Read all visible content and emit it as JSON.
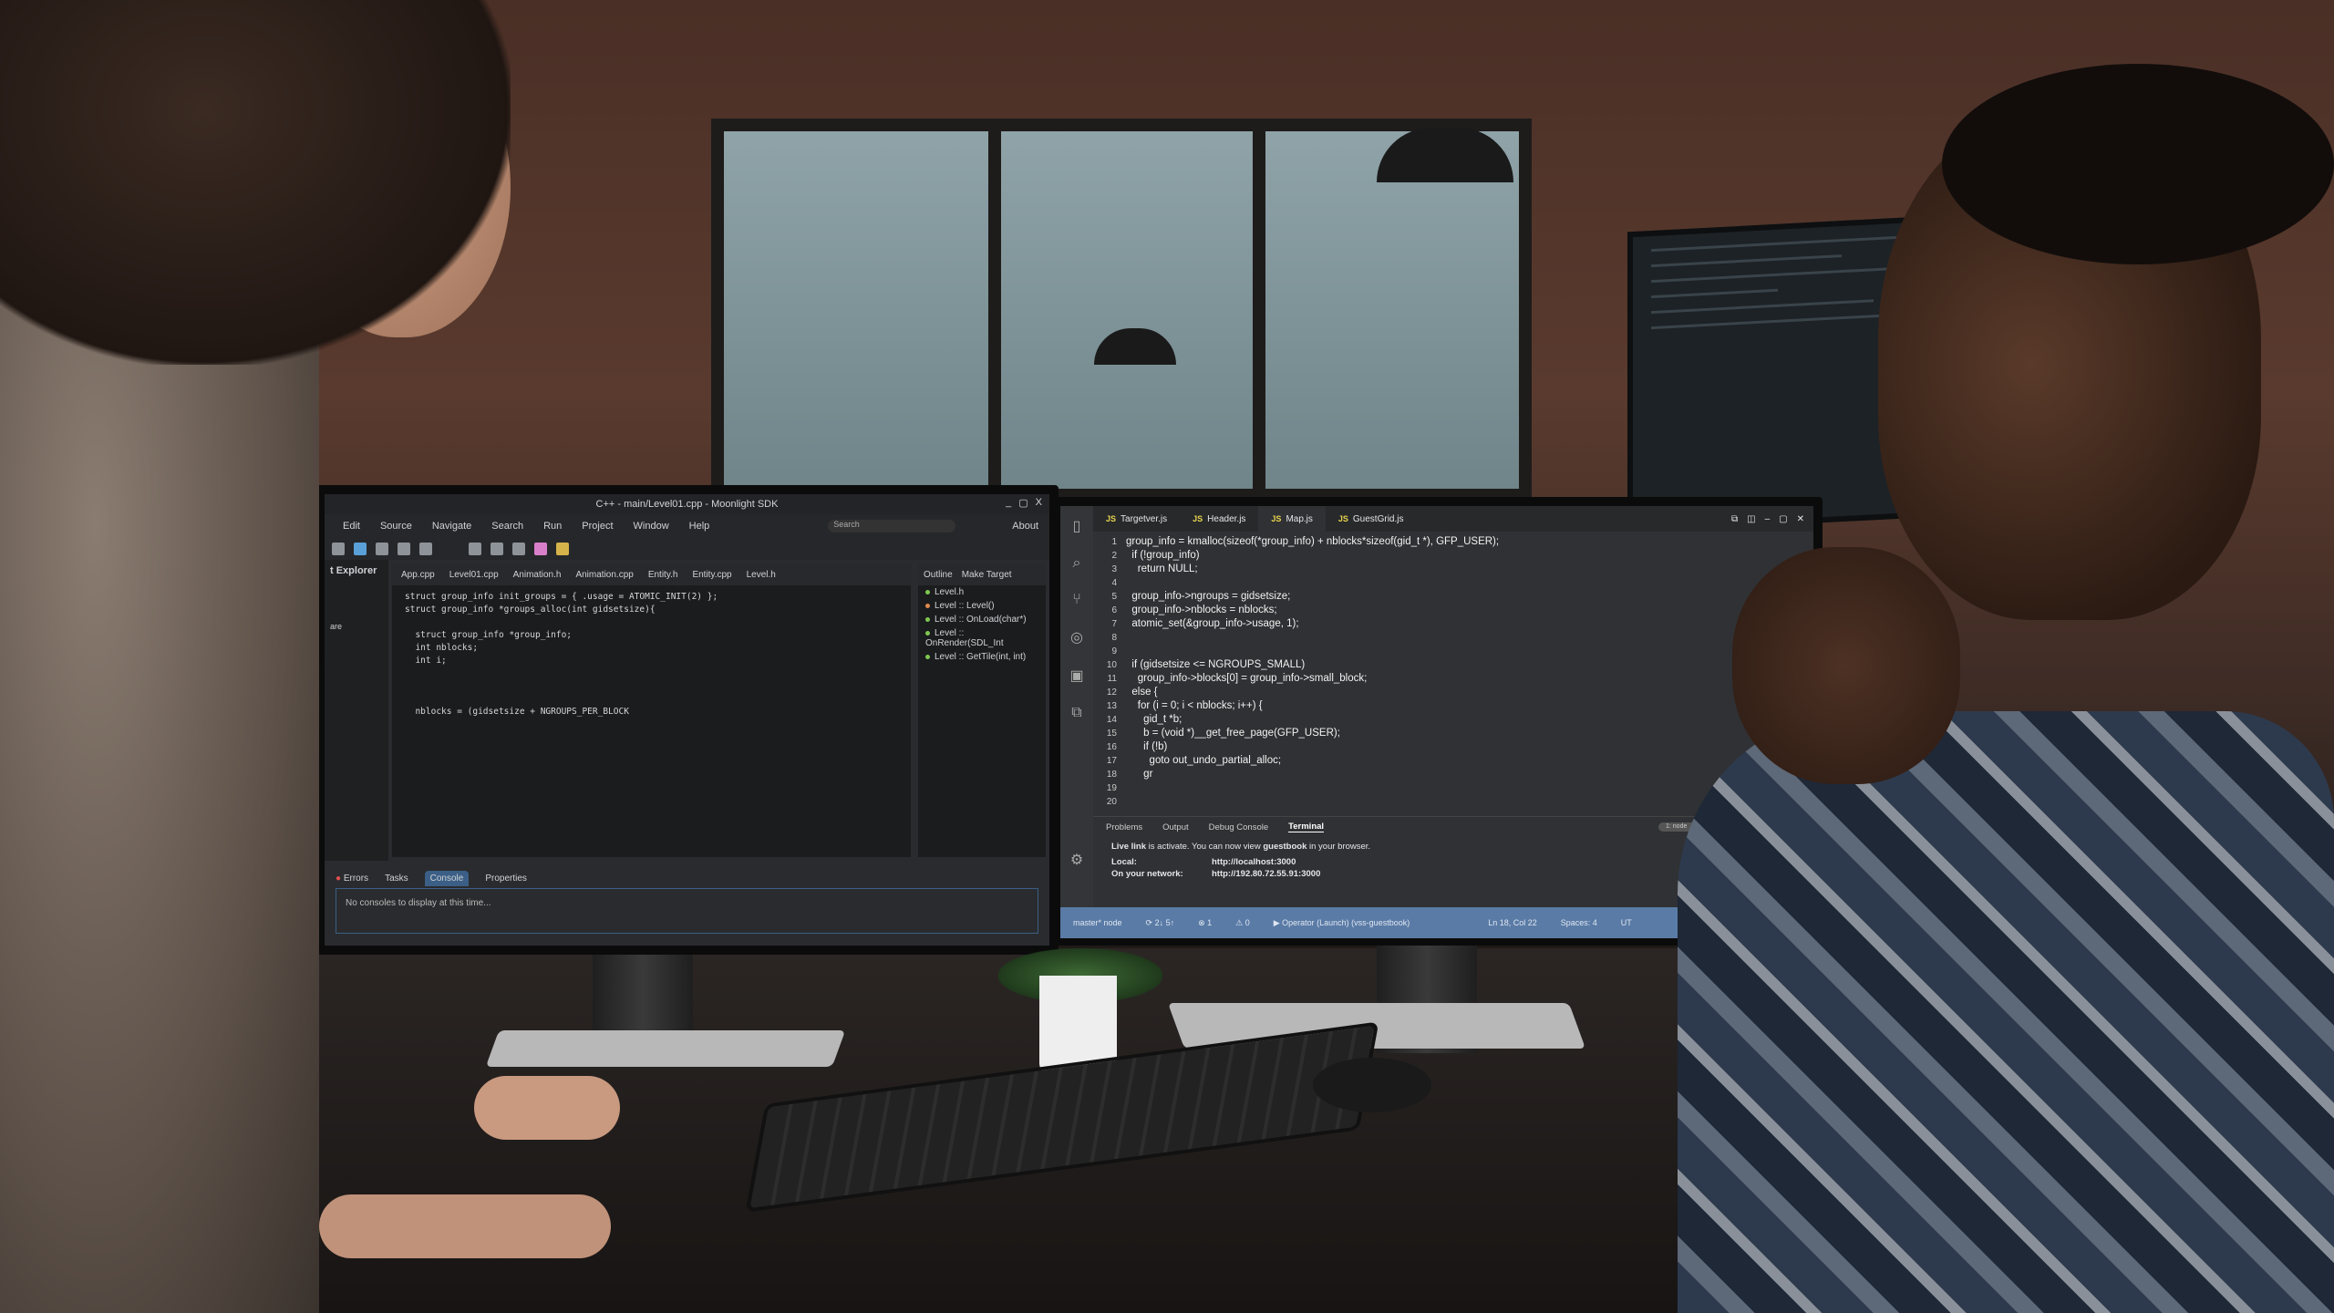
{
  "left_ide": {
    "title": "C++ - main/Level01.cpp - Moonlight SDK",
    "window_controls": [
      "_",
      "▢",
      "X"
    ],
    "menu": [
      "Edit",
      "Source",
      "Navigate",
      "Search",
      "Run",
      "Project",
      "Window",
      "Help"
    ],
    "search_placeholder": "Search",
    "about": "About",
    "explorer_title": "t Explorer",
    "explorer_item": "are",
    "editor_tabs": [
      "App.cpp",
      "Level01.cpp",
      "Animation.h",
      "Animation.cpp",
      "Entity.h",
      "Entity.cpp",
      "Level.h"
    ],
    "code": "struct group_info init_groups = { .usage = ATOMIC_INIT(2) };\nstruct group_info *groups_alloc(int gidsetsize){\n\n  struct group_info *group_info;\n  int nblocks;\n  int i;\n\n\n\n  nblocks = (gidsetsize + NGROUPS_PER_BLOCK",
    "outline_tabs": [
      "Outline",
      "Make Target"
    ],
    "outline_items": [
      "Level.h",
      "Level :: Level()",
      "Level :: OnLoad(char*)",
      "Level :: OnRender(SDL_Int",
      "Level :: GetTile(int, int)"
    ],
    "bottom_tabs": [
      "Errors",
      "Tasks",
      "Console",
      "Properties"
    ],
    "console_message": "No consoles to display at this time..."
  },
  "right_ide": {
    "tabs": [
      {
        "icon": "JS",
        "label": "Targetver.js",
        "active": false
      },
      {
        "icon": "JS",
        "label": "Header.js",
        "active": false
      },
      {
        "icon": "JS",
        "label": "Map.js",
        "active": true
      },
      {
        "icon": "JS",
        "label": "GuestGrid.js",
        "active": false
      }
    ],
    "line_numbers": "1\n2\n3\n4\n5\n6\n7\n8\n9\n10\n11\n12\n13\n14\n15\n16\n17\n18\n19\n20",
    "code": "group_info = kmalloc(sizeof(*group_info) + nblocks*sizeof(gid_t *), GFP_USER);\n  if (!group_info)\n    return NULL;\n\n  group_info->ngroups = gidsetsize;\n  group_info->nblocks = nblocks;\n  atomic_set(&group_info->usage, 1);\n\n\n  if (gidsetsize <= NGROUPS_SMALL)\n    group_info->blocks[0] = group_info->small_block;\n  else {\n    for (i = 0; i < nblocks; i++) {\n      gid_t *b;\n      b = (void *)__get_free_page(GFP_USER);\n      if (!b)\n        goto out_undo_partial_alloc;\n      gr\n",
    "panel_tabs": [
      "Problems",
      "Output",
      "Debug Console",
      "Terminal"
    ],
    "active_panel": "Terminal",
    "terminal_select": "1: node",
    "terminal": {
      "message_bold1": "Live link",
      "message_mid": " is activate. You can now view ",
      "message_bold2": "guestbook",
      "message_end": " in your browser.",
      "local_label": "Local:",
      "local_url": "http://localhost:3000",
      "network_label": "On your network:",
      "network_url": "http://192.80.72.55.91:3000"
    },
    "status_bar": [
      "master* node",
      "⟳ 2↓ 5↑",
      "⊗ 1",
      "⚠ 0",
      "▶ Operator (Launch) (vss-guestbook)",
      "Ln 18, Col 22",
      "Spaces: 4",
      "UT"
    ],
    "status_color": "#5a7ba6"
  }
}
